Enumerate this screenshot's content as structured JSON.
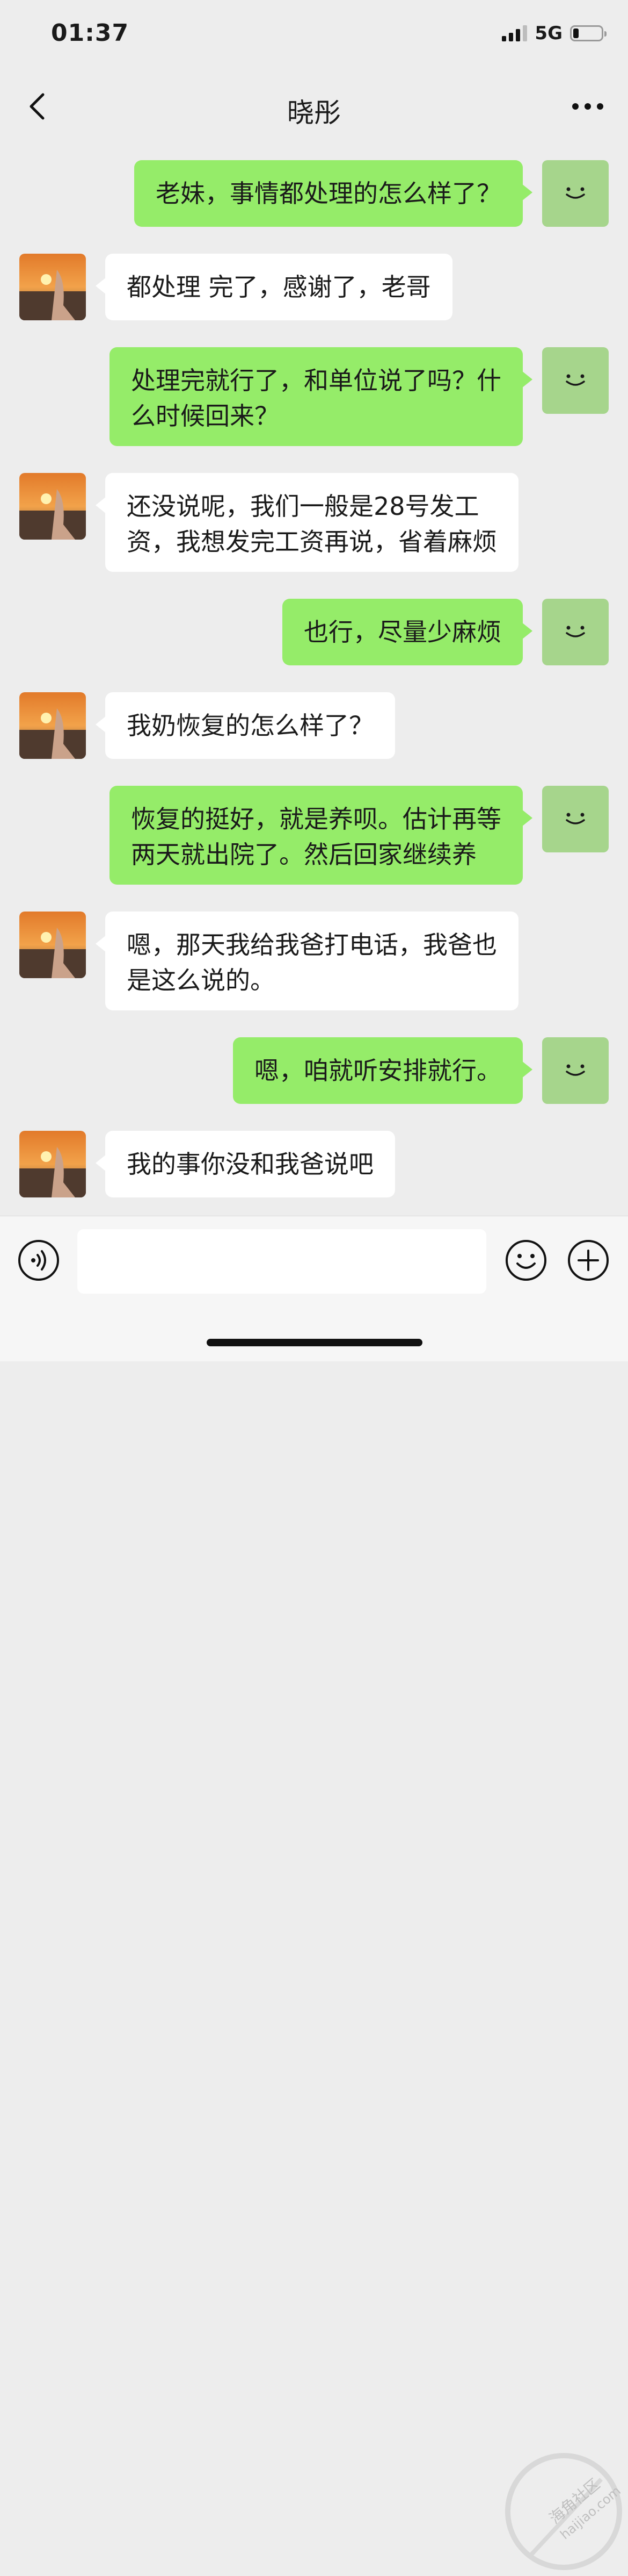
{
  "status_bar": {
    "time": "01:37",
    "network": "5G"
  },
  "nav": {
    "title": "晓彤"
  },
  "messages": [
    {
      "from": "self",
      "text": "老妹，事情都处理的怎么样了？"
    },
    {
      "from": "other",
      "text": "都处理 完了，感谢了，老哥"
    },
    {
      "from": "self",
      "text": "处理完就行了，和单位说了吗？什\n么时候回来？"
    },
    {
      "from": "other",
      "text": "还没说呢，我们一般是28号发工\n资，我想发完工资再说，省着麻烦"
    },
    {
      "from": "self",
      "text": "也行，尽量少麻烦"
    },
    {
      "from": "other",
      "text": "我奶恢复的怎么样了？"
    },
    {
      "from": "self",
      "text": "恢复的挺好，就是养呗。估计再等\n两天就出院了。然后回家继续养"
    },
    {
      "from": "other",
      "text": "嗯，那天我给我爸打电话，我爸也\n是这么说的。"
    },
    {
      "from": "self",
      "text": "嗯，咱就听安排就行。"
    },
    {
      "from": "other",
      "text": "我的事你没和我爸说吧"
    }
  ],
  "input": {
    "value": ""
  },
  "watermark": {
    "text1": "海角社区",
    "text2": "haijiao.com"
  },
  "colors": {
    "self_bubble": "#95ec69",
    "other_bubble": "#ffffff",
    "background": "#ededed"
  }
}
